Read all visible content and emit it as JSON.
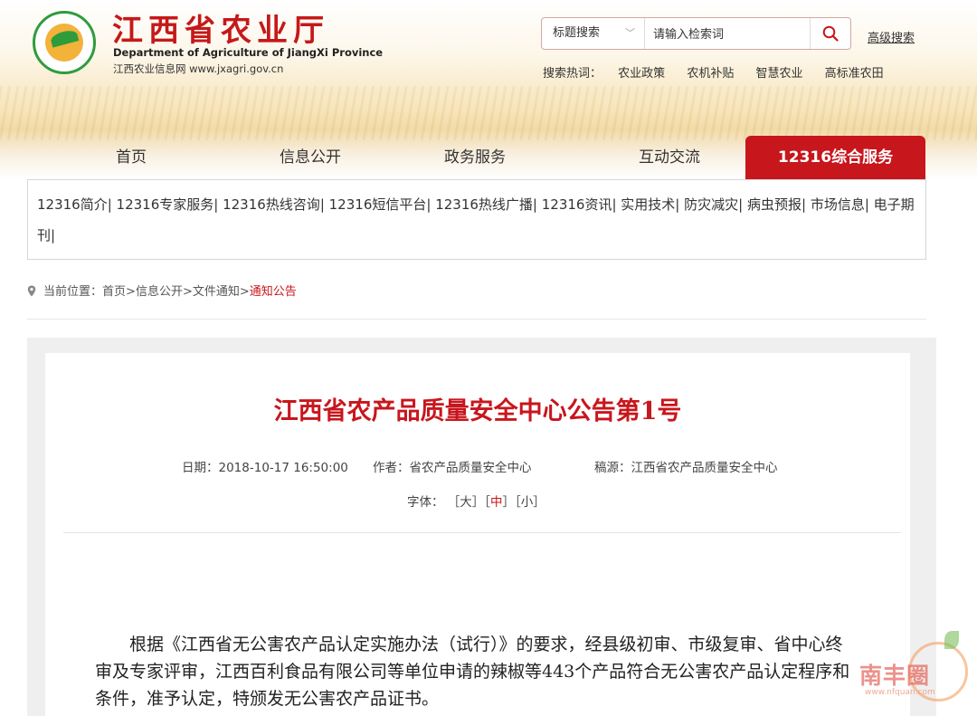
{
  "site": {
    "title_cn": "江西省农业厅",
    "title_en": "Department of Agriculture of JiangXi Province",
    "url_line": "江西农业信息网 www.jxagri.gov.cn",
    "logo_icon": "agriculture-logo",
    "accent_color": "#c8161d"
  },
  "search": {
    "type_label": "标题搜索",
    "placeholder": "请输入检索词",
    "advanced_label": "高级搜索",
    "hot_label": "搜索热词：",
    "hot_words": [
      "农业政策",
      "农机补贴",
      "智慧农业",
      "高标准农田"
    ]
  },
  "nav": {
    "items": [
      "首页",
      "信息公开",
      "政务服务",
      "互动交流",
      "12316综合服务"
    ],
    "active_index": 4
  },
  "subnav": {
    "items": [
      "12316简介",
      "12316专家服务",
      "12316热线咨询",
      "12316短信平台",
      "12316热线广播",
      "12316资讯",
      "实用技术",
      "防灾减灾",
      "病虫预报",
      "市场信息",
      "电子期刊"
    ]
  },
  "breadcrumb": {
    "label": "当前位置：",
    "items": [
      "首页",
      "信息公开",
      "文件通知",
      "通知公告"
    ]
  },
  "article": {
    "title": "江西省农产品质量安全中心公告第1号",
    "date": "日期：2018-10-17 16:50:00",
    "author": "作者：省农产品质量安全中心",
    "source": "稿源：江西省农产品质量安全中心",
    "font_label": "字体：",
    "font_sizes": [
      "大",
      "中",
      "小"
    ],
    "body": "根据《江西省无公害农产品认定实施办法（试行）》的要求，经县级初审、市级复审、省中心终审及专家评审，江西百利食品有限公司等单位申请的辣椒等443个产品符合无公害农产品认定程序和条件，准予认定，特颁发无公害农产品证书。"
  },
  "watermark": {
    "text": "南丰圈",
    "url": "www.nfquan.com"
  }
}
